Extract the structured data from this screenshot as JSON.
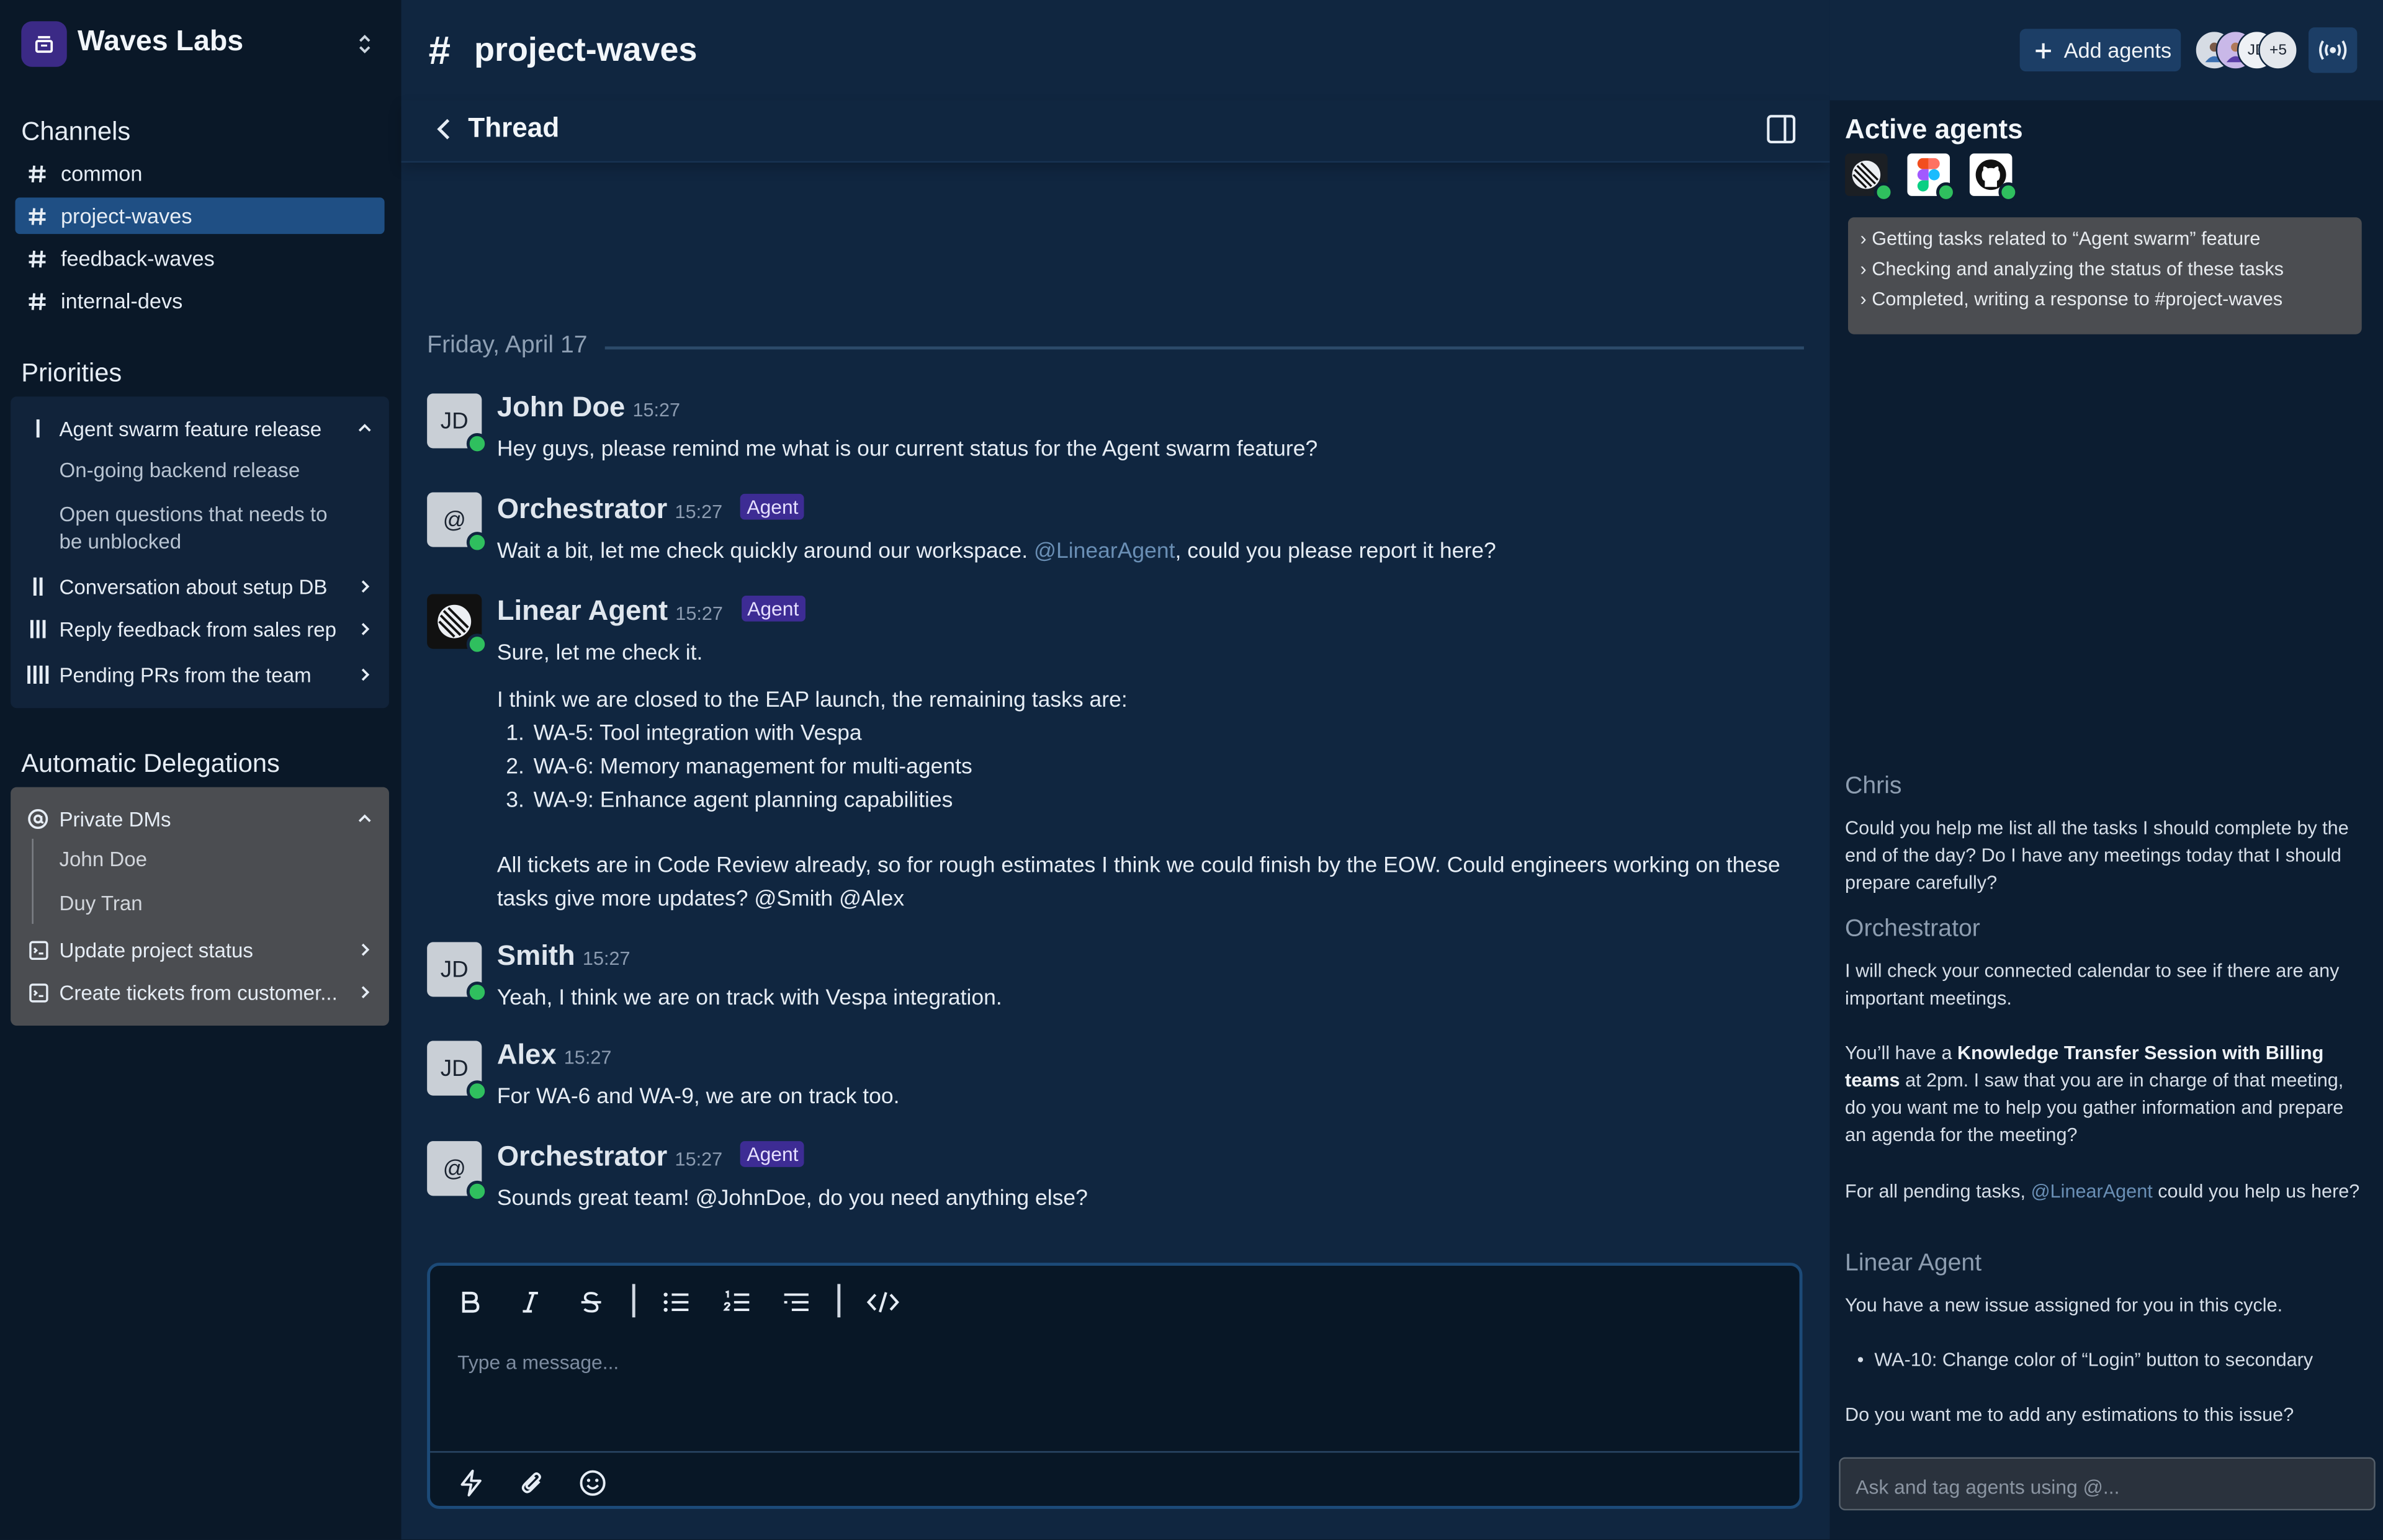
{
  "workspace": {
    "name": "Waves Labs"
  },
  "sidebar": {
    "channels_title": "Channels",
    "channels": [
      {
        "label": "common"
      },
      {
        "label": "project-waves",
        "selected": true
      },
      {
        "label": "feedback-waves"
      },
      {
        "label": "internal-devs"
      }
    ],
    "priorities_title": "Priorities",
    "priorities": {
      "expanded": {
        "label": "Agent swarm feature release",
        "children": [
          "On-going backend release",
          "Open questions that needs to be unblocked"
        ]
      },
      "items": [
        {
          "label": "Conversation about setup DB"
        },
        {
          "label": "Reply feedback from sales rep"
        },
        {
          "label": "Pending PRs from the team"
        }
      ]
    },
    "delegations_title": "Automatic Delegations",
    "delegations": {
      "expanded": {
        "label": "Private DMs",
        "children": [
          "John Doe",
          "Duy Tran"
        ]
      },
      "items": [
        {
          "label": "Update project status"
        },
        {
          "label": "Create tickets from customer..."
        }
      ]
    }
  },
  "header": {
    "channel": "project-waves",
    "add_agents_label": "Add agents",
    "avatar_initials": "JD",
    "avatar_more": "+5"
  },
  "thread": {
    "title": "Thread",
    "date_separator": "Friday, April 17",
    "messages": [
      {
        "author": "John Doe",
        "time": "15:27",
        "avatar": "JD",
        "text": "Hey guys, please remind me what is our current status for the Agent swarm feature?"
      },
      {
        "author": "Orchestrator",
        "time": "15:27",
        "badge": "Agent",
        "avatar": "@",
        "text_before": "Wait a bit, let me check quickly around our workspace. ",
        "mention": "@LinearAgent",
        "text_after": ", could you please report it here?"
      },
      {
        "author": "Linear Agent",
        "time": "15:27",
        "badge": "Agent",
        "text_intro": "Sure, let me check it.",
        "text_list_intro": "I think we are closed to the EAP launch, the remaining tasks are:",
        "list": [
          "WA-5:  Tool integration with Vespa",
          "WA-6: Memory management for multi-agents",
          "WA-9: Enhance agent planning capabilities"
        ],
        "text_outro": "All tickets are in Code Review already, so for rough estimates I think we could finish by the EOW. Could engineers working on these tasks give more updates? @Smith @Alex"
      },
      {
        "author": "Smith",
        "time": "15:27",
        "avatar": "JD",
        "text": "Yeah, I think we are on track with Vespa integration."
      },
      {
        "author": "Alex",
        "time": "15:27",
        "avatar": "JD",
        "text": "For WA-6 and WA-9, we are on track too."
      },
      {
        "author": "Orchestrator",
        "time": "15:27",
        "badge": "Agent",
        "avatar": "@",
        "text": "Sounds great team! @JohnDoe, do you need anything else?"
      }
    ]
  },
  "composer": {
    "placeholder": "Type a message..."
  },
  "right_panel": {
    "title": "Active agents",
    "agents": [
      "linear-icon",
      "figma-icon",
      "github-icon"
    ],
    "activity": [
      "Getting tasks related to “Agent swarm” feature",
      "Checking and analyzing the status of these tasks",
      "Completed, writing a response to #project-waves"
    ],
    "chat": {
      "chris_name": "Chris",
      "chris_text": "Could you help me list all the tasks I should complete by the end of the day? Do I have any meetings today that I should prepare carefully?",
      "orch_name": "Orchestrator",
      "orch_text1": "I will check your connected calendar to see if there are any important meetings.",
      "orch_text2_before": "You’ll have a ",
      "orch_text2_bold": "Knowledge Transfer Session with Billing teams",
      "orch_text2_after": " at 2pm. I saw that you are in charge of that meeting, do you want me to help you gather information and prepare an agenda for the meeting?",
      "orch_text3_before": "For all pending tasks, ",
      "orch_text3_mention": "@LinearAgent",
      "orch_text3_after": " could you help us here?",
      "linear_name": "Linear Agent",
      "linear_text1": "You have a new issue assigned for you in this cycle.",
      "linear_bullet": "WA-10: Change color of “Login” button to secondary",
      "linear_text2": "Do you want me to add any estimations to this issue?"
    },
    "ask_placeholder": "Ask and tag agents using @..."
  },
  "colors": {
    "accent": "#1f4f84",
    "agent_badge": "#3d2c94",
    "online": "#2fbf5e",
    "mention": "#6a8fb5"
  }
}
